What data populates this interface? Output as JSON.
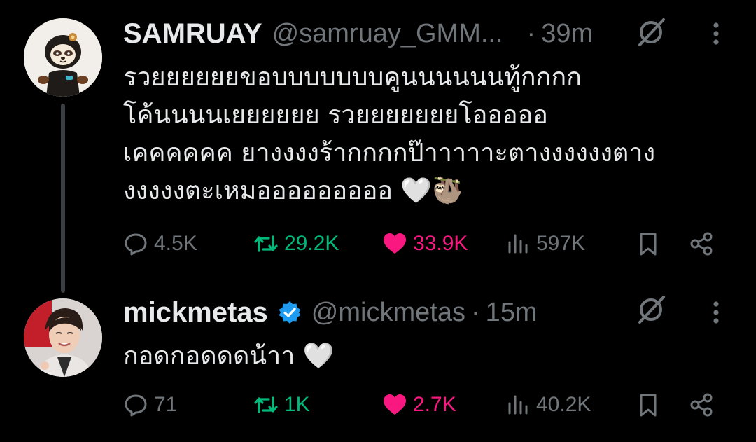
{
  "tweets": [
    {
      "display_name": "SAMRUAY",
      "handle": "@samruay_GMM...",
      "separator": "·",
      "time": "39m",
      "verified": false,
      "text": "รวยยยยยยขอบบบบบบบคูนนนนนนทู้กกกก\nโค้นนนนเยยยยยย รวยยยยยยยโอออออ\nเคคคคคค ยางงงงร้ากกกกป๊าาาาาะตางงงงงงตาง\nงงงงงตะเหมอออออออออ 🤍🦥",
      "counts": {
        "replies": "4.5K",
        "reposts": "29.2K",
        "likes": "33.9K",
        "views": "597K"
      },
      "liked": true,
      "reposted": true,
      "avatar": "sloth-cartoon-avatar"
    },
    {
      "display_name": "mickmetas",
      "handle": "@mickmetas",
      "separator": "·",
      "time": "15m",
      "verified": true,
      "text": "กอดกอดดดน้าา 🤍",
      "counts": {
        "replies": "71",
        "reposts": "1K",
        "likes": "2.7K",
        "views": "40.2K"
      },
      "liked": true,
      "reposted": true,
      "avatar": "person-photo-avatar"
    }
  ],
  "icons": {
    "reply": "reply-icon",
    "repost": "repost-icon",
    "like": "heart-icon",
    "views": "views-icon",
    "bookmark": "bookmark-icon",
    "share": "share-icon",
    "grok": "grok-icon",
    "more": "more-vertical-icon",
    "verified": "verified-badge-icon"
  },
  "colors": {
    "background": "#000000",
    "text_primary": "#e7e9ea",
    "text_secondary": "#71767b",
    "repost_green": "#00ba7c",
    "like_pink": "#f91880",
    "verified_blue": "#1d9bf0",
    "thread_line": "#3b3e42"
  }
}
